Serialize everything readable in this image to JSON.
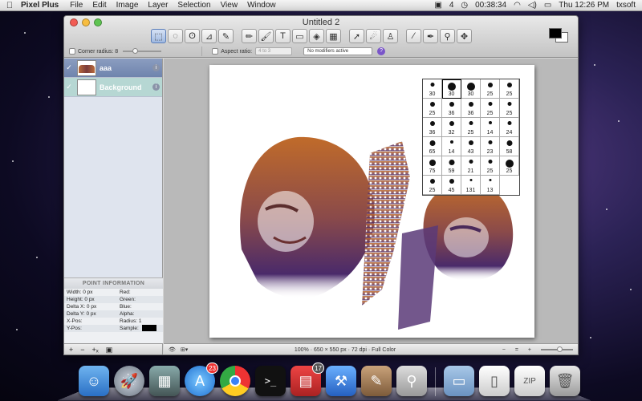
{
  "menubar": {
    "app_name": "Pixel Plus",
    "items": [
      "File",
      "Edit",
      "Image",
      "Layer",
      "Selection",
      "View",
      "Window"
    ],
    "status": {
      "badge_count": "4",
      "timer": "00:38:34",
      "clock": "Thu 12:26 PM",
      "user": "txsoft"
    }
  },
  "window": {
    "title": "Untitled 2",
    "tools": [
      {
        "name": "rect-select-tool",
        "glyph": "⬚"
      },
      {
        "name": "ellipse-select-tool",
        "glyph": "◌"
      },
      {
        "name": "lasso-tool",
        "glyph": "ʘ"
      },
      {
        "name": "polygon-lasso-tool",
        "glyph": "⊿"
      },
      {
        "name": "magic-wand-tool",
        "glyph": "✎"
      },
      {
        "name": "pencil-tool",
        "glyph": "✏"
      },
      {
        "name": "brush-tool",
        "glyph": "🖌"
      },
      {
        "name": "text-tool",
        "glyph": "T"
      },
      {
        "name": "eraser-tool",
        "glyph": "▭"
      },
      {
        "name": "fill-tool",
        "glyph": "◈"
      },
      {
        "name": "gradient-tool",
        "glyph": "▦"
      },
      {
        "name": "move-tool",
        "glyph": "➚"
      },
      {
        "name": "smudge-tool",
        "glyph": "☄"
      },
      {
        "name": "stamp-tool",
        "glyph": "♙"
      },
      {
        "name": "eyedropper-tool",
        "glyph": "⁄"
      },
      {
        "name": "color-picker-tool",
        "glyph": "✒"
      },
      {
        "name": "zoom-tool",
        "glyph": "⚲"
      },
      {
        "name": "pan-tool",
        "glyph": "✥"
      }
    ],
    "options": {
      "corner_radius_label": "Corner radius: 8",
      "aspect_ratio_label": "Aspect ratio:",
      "aspect_ratio_value": "4 to 3",
      "modifiers_value": "No modifiers active",
      "help_label": "?"
    },
    "layers": [
      {
        "name": "aaa"
      },
      {
        "name": "Background"
      }
    ],
    "point_info": {
      "title": "POINT INFORMATION",
      "width": "Width:  0 px",
      "height": "Height:  0 px",
      "delta_x": "Delta X:  0 px",
      "delta_y": "Delta Y:  0 px",
      "x_pos": "X-Pos:",
      "y_pos": "Y-Pos:",
      "red": "Red:",
      "green": "Green:",
      "blue": "Blue:",
      "alpha": "Alpha:",
      "radius": "Radius:  1",
      "sample": "Sample:"
    },
    "layer_buttons": [
      "+",
      "−",
      "+ₓ",
      "▣"
    ],
    "status_text": "100% · 650 × 550 px · 72 dpi · Full Color",
    "zoom_buttons": [
      "−",
      "=",
      "+"
    ]
  },
  "brushes": [
    "30",
    "30",
    "30",
    "25",
    "25",
    "25",
    "36",
    "36",
    "25",
    "25",
    "36",
    "32",
    "25",
    "14",
    "24",
    "65",
    "14",
    "43",
    "23",
    "58",
    "75",
    "59",
    "21",
    "25",
    "25",
    "25",
    "45",
    "131",
    "13"
  ],
  "dock": {
    "app_store_badge": "23",
    "calendar_badge": "17"
  }
}
